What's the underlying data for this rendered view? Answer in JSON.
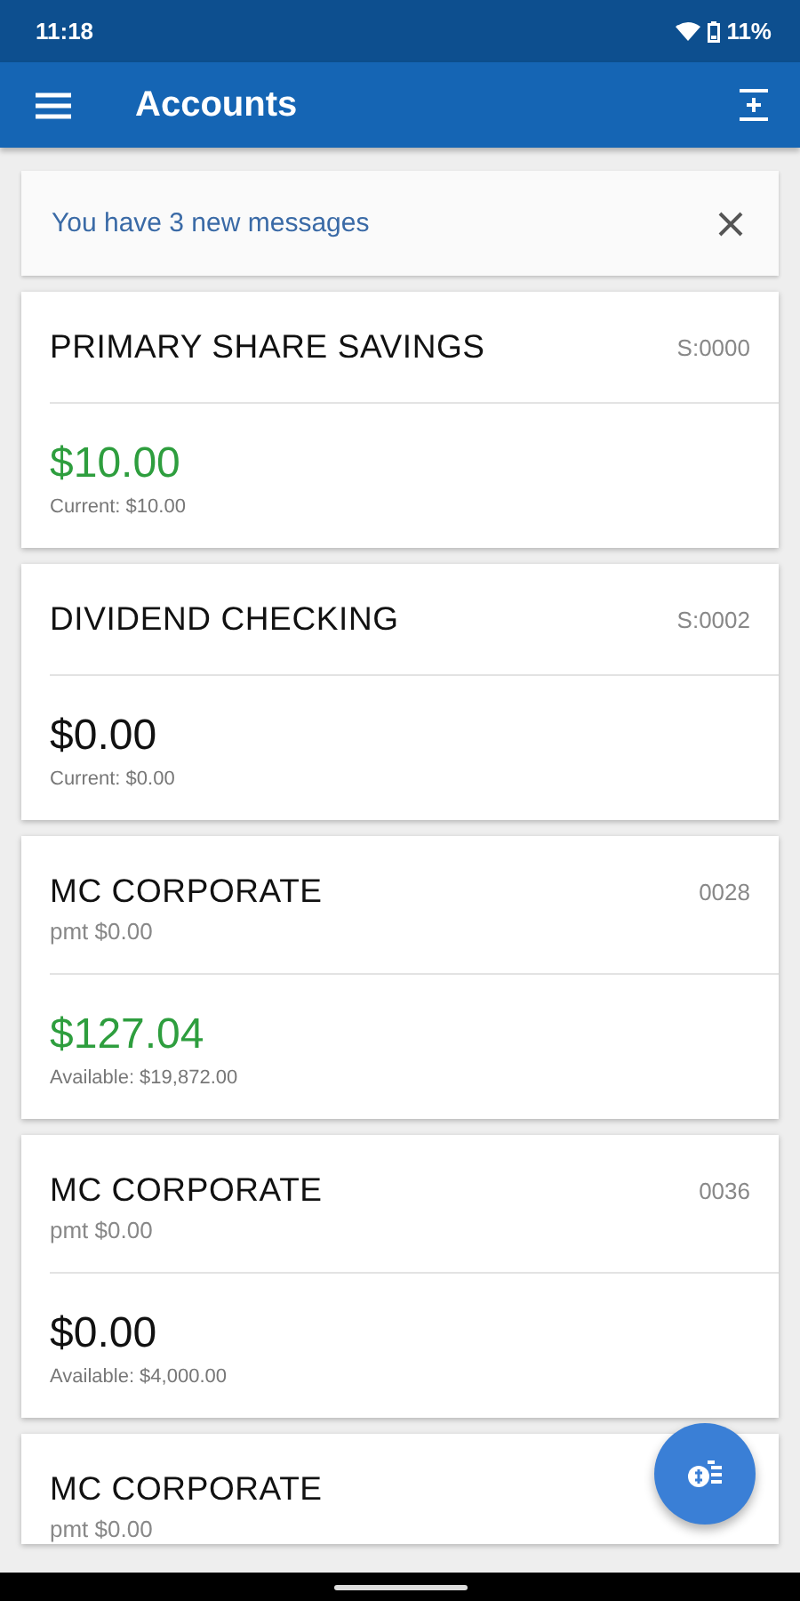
{
  "status_bar": {
    "time": "11:18",
    "battery": "11%"
  },
  "app_bar": {
    "title": "Accounts"
  },
  "banner": {
    "text": "You have 3 new messages"
  },
  "accounts": [
    {
      "name": "PRIMARY SHARE SAVINGS",
      "number": "S:0000",
      "balance": "$10.00",
      "positive": true,
      "detail": "Current: $10.00"
    },
    {
      "name": "DIVIDEND CHECKING",
      "number": "S:0002",
      "balance": "$0.00",
      "positive": false,
      "detail": "Current: $0.00"
    },
    {
      "name": "MC CORPORATE",
      "number": "0028",
      "payment": "pmt $0.00",
      "balance": "$127.04",
      "positive": true,
      "detail": "Available: $19,872.00"
    },
    {
      "name": "MC CORPORATE",
      "number": "0036",
      "payment": "pmt $0.00",
      "balance": "$0.00",
      "positive": false,
      "detail": "Available: $4,000.00"
    },
    {
      "name": "MC CORPORATE",
      "payment": "pmt $0.00"
    }
  ]
}
